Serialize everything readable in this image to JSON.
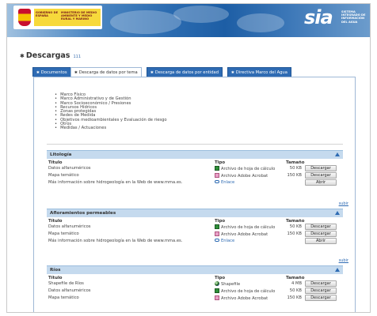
{
  "header": {
    "gov_label": "GOBIERNO DE ESPAÑA",
    "ministry_label": "MINISTERIO DE MEDIO AMBIENTE Y MEDIO RURAL Y MARINO",
    "sia_logo": "sia",
    "sia_subtitle": "SISTEMA INTEGRADO DE INFORMACIÓN DEL AGUA"
  },
  "page": {
    "title": "Descargas",
    "badge": "111"
  },
  "tabs": [
    {
      "label": "Documentos"
    },
    {
      "label": "Descarga de datos por tema"
    },
    {
      "label": "Descarga de datos por entidad"
    },
    {
      "label": "Directiva Marco del Agua"
    }
  ],
  "topics": [
    "Marco Físico",
    "Marco Administrativo y de Gestión",
    "Marco Socioeconómico / Presiones",
    "Recursos Hídricos",
    "Zonas protegidas",
    "Redes de Medida",
    "Objetivos medioambientales y Evaluación de riesgo",
    "Otros",
    "Medidas / Actuaciones"
  ],
  "columns": {
    "title": "Título",
    "type": "Tipo",
    "size": "Tamaño"
  },
  "subir_label": "subir",
  "sections": [
    {
      "title": "Litología",
      "rows": [
        {
          "title": "Datos alfanuméricos",
          "type": "Archivo de hoja de cálculo",
          "icon": "spreadsheet-icon",
          "size": "50 KB",
          "action": "Descargar"
        },
        {
          "title": "Mapa temático",
          "type": "Archivo Adobe Acrobat",
          "icon": "pdf-icon",
          "size": "150 KB",
          "action": "Descargar"
        },
        {
          "title": "Más información sobre hidrogeología en la Web de www.mma.es.",
          "type": "Enlace",
          "icon": "link-icon",
          "size": "",
          "action": "Abrir"
        }
      ]
    },
    {
      "title": "Afloramientos permeables",
      "rows": [
        {
          "title": "Datos alfanuméricos",
          "type": "Archivo de hoja de cálculo",
          "icon": "spreadsheet-icon",
          "size": "50 KB",
          "action": "Descargar"
        },
        {
          "title": "Mapa temático",
          "type": "Archivo Adobe Acrobat",
          "icon": "pdf-icon",
          "size": "150 KB",
          "action": "Descargar"
        },
        {
          "title": "Más información sobre hidrogeología en la Web de www.mma.es.",
          "type": "Enlace",
          "icon": "link-icon",
          "size": "",
          "action": "Abrir"
        }
      ]
    },
    {
      "title": "Ríos",
      "rows": [
        {
          "title": "Shapefile de Ríos",
          "type": "Shapefile",
          "icon": "shapefile-icon",
          "size": "4 MB",
          "action": "Descargar"
        },
        {
          "title": "Datos alfanuméricos",
          "type": "Archivo de hoja de cálculo",
          "icon": "spreadsheet-icon",
          "size": "50 KB",
          "action": "Descargar"
        },
        {
          "title": "Mapa temático",
          "type": "Archivo Adobe Acrobat",
          "icon": "pdf-icon",
          "size": "150 KB",
          "action": "Descargar"
        }
      ]
    }
  ],
  "colors": {
    "header_blue": "#2b6bb3",
    "section_bg": "#c5daee",
    "link": "#2e6bb3"
  }
}
